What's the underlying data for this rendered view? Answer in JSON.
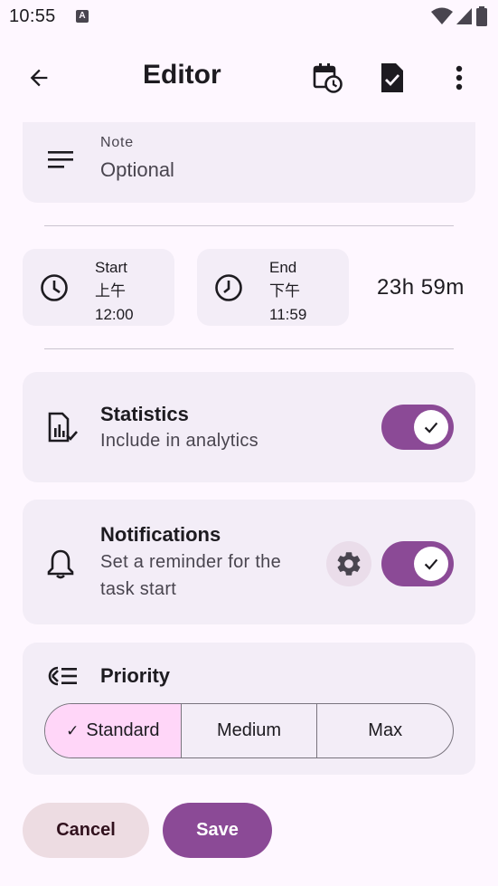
{
  "status_bar": {
    "time": "10:55",
    "notification_glyph": "A"
  },
  "app_bar": {
    "title": "Editor",
    "icons": [
      "arrow-back-icon",
      "calendar-clock-icon",
      "task-check-icon",
      "more-vert-icon"
    ]
  },
  "note": {
    "label": "Note",
    "value": "Optional",
    "icon": "notes-icon"
  },
  "start": {
    "label": "Start",
    "period": "上午",
    "time": "12:00",
    "icon": "clock-icon"
  },
  "end": {
    "label": "End",
    "period": "下午",
    "time": "11:59",
    "icon": "clock-icon"
  },
  "duration": "23h 59m",
  "statistics": {
    "title": "Statistics",
    "subtitle": "Include in analytics",
    "enabled": true
  },
  "notifications": {
    "title": "Notifications",
    "subtitle_line1": "Set a reminder for the",
    "subtitle_line2": "task start",
    "enabled": true
  },
  "priority": {
    "title": "Priority",
    "options": [
      "Standard",
      "Medium",
      "Max"
    ],
    "selected": "Standard"
  },
  "actions": {
    "cancel": "Cancel",
    "save": "Save"
  },
  "colors": {
    "accent": "#8B4A96",
    "surface": "#F3EDF7",
    "background": "#FEF7FF",
    "selected_segment": "#FFD6F8",
    "cancel_bg": "#EDDCE2"
  }
}
